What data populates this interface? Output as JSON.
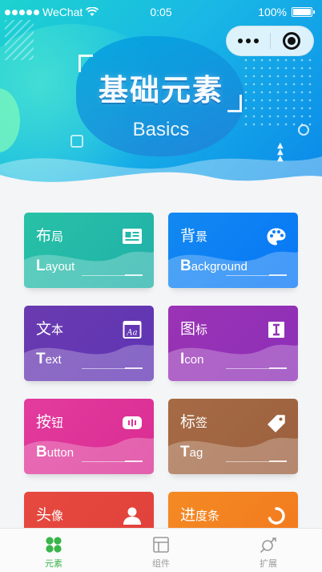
{
  "status_bar": {
    "carrier": "WeChat",
    "time": "0:05",
    "battery": "100%"
  },
  "header": {
    "title": "基础元素",
    "subtitle": "Basics"
  },
  "cards": [
    {
      "name_main": "布",
      "name_rest": "局",
      "en_first": "L",
      "en_rest": "ayout",
      "icon": "newspaper-icon",
      "color": "#28c1a6"
    },
    {
      "name_main": "背",
      "name_rest": "景",
      "en_first": "B",
      "en_rest": "ackground",
      "icon": "palette-icon",
      "color": "#1289f0"
    },
    {
      "name_main": "文",
      "name_rest": "本",
      "en_first": "T",
      "en_rest": "ext",
      "icon": "text-aa-icon",
      "color": "#6a3bb0"
    },
    {
      "name_main": "图",
      "name_rest": "标",
      "en_first": "I",
      "en_rest": "con",
      "icon": "icon-i-icon",
      "color": "#9b33b5"
    },
    {
      "name_main": "按",
      "name_rest": "钮",
      "en_first": "B",
      "en_rest": "utton",
      "icon": "button-icon",
      "color": "#e33b9e"
    },
    {
      "name_main": "标",
      "name_rest": "签",
      "en_first": "T",
      "en_rest": "ag",
      "icon": "tag-icon",
      "color": "#a66b45"
    },
    {
      "name_main": "头",
      "name_rest": "像",
      "en_first": "",
      "en_rest": "",
      "icon": "user-icon",
      "color": "#e6493f"
    },
    {
      "name_main": "进",
      "name_rest": "度条",
      "en_first": "",
      "en_rest": "",
      "icon": "loading-icon",
      "color": "#f48a24"
    }
  ],
  "tabbar": {
    "items": [
      {
        "label": "元素",
        "icon": "elements-icon",
        "active": true
      },
      {
        "label": "组件",
        "icon": "components-icon",
        "active": false
      },
      {
        "label": "扩展",
        "icon": "plugin-icon",
        "active": false
      }
    ],
    "active_color": "#39b54a",
    "inactive_color": "#9a9a9a"
  }
}
